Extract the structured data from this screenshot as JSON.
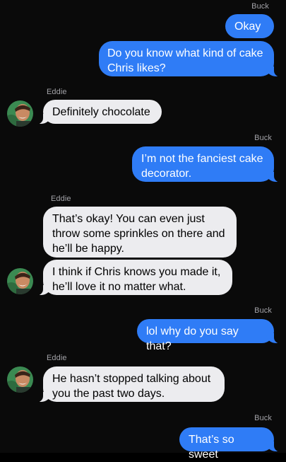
{
  "participants": {
    "me": "Buck",
    "them": "Eddie"
  },
  "colors": {
    "outgoing_bubble": "#2f7cf6",
    "incoming_bubble": "#ececef",
    "background": "#0a0a0a",
    "sender_label": "#a3a3a8"
  },
  "messages": [
    {
      "sender": "Buck",
      "text": "Okay"
    },
    {
      "sender": "Buck",
      "text": "Do you know what kind of cake Chris likes?"
    },
    {
      "sender": "Eddie",
      "text": "Definitely chocolate"
    },
    {
      "sender": "Buck",
      "text": "I’m not the fanciest cake decorator."
    },
    {
      "sender": "Eddie",
      "text": "That’s okay! You can even just throw some sprinkles on there and he’ll be happy."
    },
    {
      "sender": "Eddie",
      "text": "I think if Chris knows you made it, he’ll love it no matter what."
    },
    {
      "sender": "Buck",
      "text": "lol why do you say that?"
    },
    {
      "sender": "Eddie",
      "text": "He hasn’t stopped talking about you the past two days."
    },
    {
      "sender": "Buck",
      "text": "That’s so sweet"
    }
  ],
  "avatar_icon": "person-photo-icon"
}
